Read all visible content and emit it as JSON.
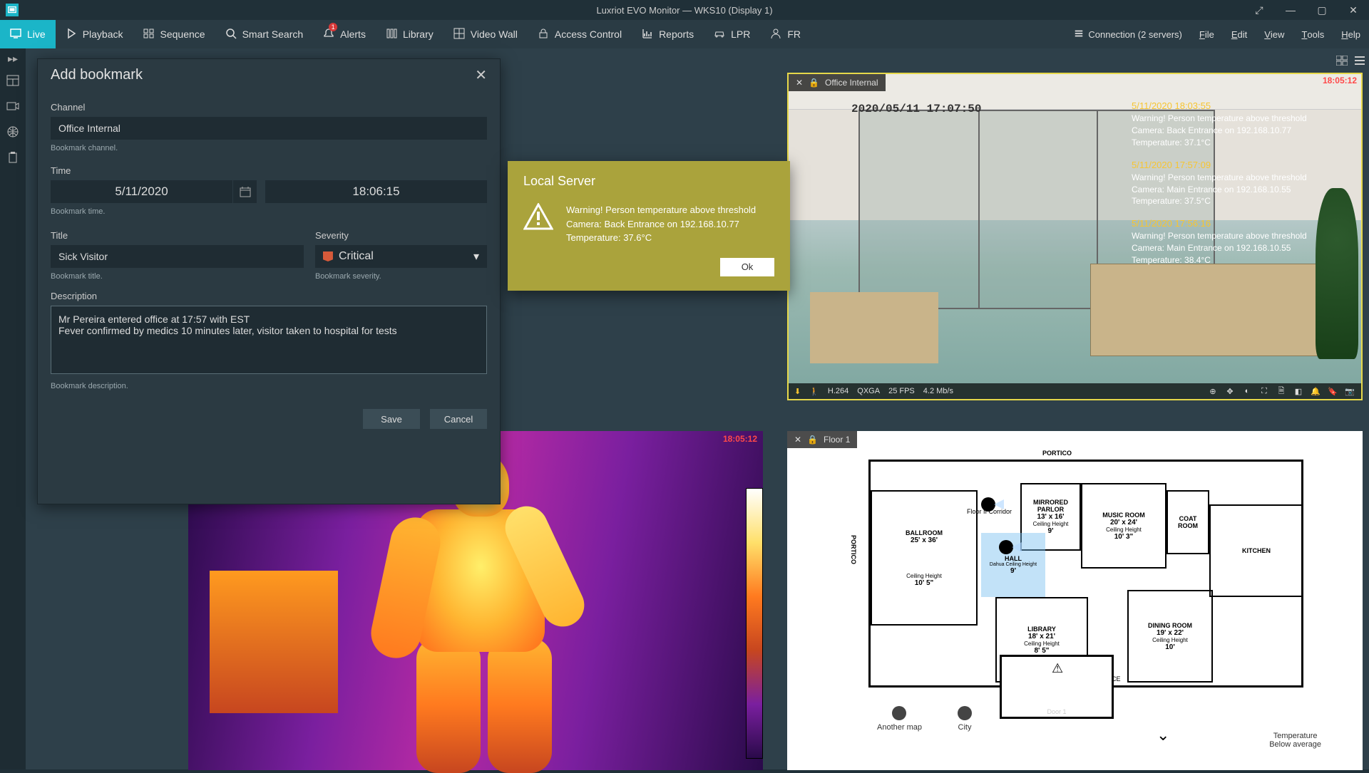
{
  "app_title": "Luxriot EVO Monitor — WKS10 (Display 1)",
  "tabs": {
    "live": "Live",
    "playback": "Playback",
    "sequence": "Sequence",
    "smart_search": "Smart Search",
    "alerts": "Alerts",
    "alerts_badge": "1",
    "library": "Library",
    "video_wall": "Video Wall",
    "access_control": "Access Control",
    "reports": "Reports",
    "lpr": "LPR",
    "fr": "FR"
  },
  "right_menu": {
    "connection": "Connection (2 servers)",
    "file": "File",
    "edit": "Edit",
    "view": "View",
    "tools": "Tools",
    "help": "Help"
  },
  "bookmark": {
    "title": "Add bookmark",
    "channel_label": "Channel",
    "channel_value": "Office Internal",
    "channel_hint": "Bookmark channel.",
    "time_label": "Time",
    "date_value": "5/11/2020",
    "time_value": "18:06:15",
    "time_hint": "Bookmark time.",
    "title_label": "Title",
    "title_value": "Sick Visitor",
    "title_hint": "Bookmark title.",
    "severity_label": "Severity",
    "severity_value": "Critical",
    "severity_hint": "Bookmark severity.",
    "description_label": "Description",
    "description_value": "Mr Pereira entered office at 17:57 with EST\nFever confirmed by medics 10 minutes later, visitor taken to hospital for tests",
    "description_hint": "Bookmark description.",
    "save": "Save",
    "cancel": "Cancel"
  },
  "alert_dialog": {
    "title": "Local Server",
    "line1": "Warning! Person temperature above threshold",
    "line2": "Camera: Back Entrance on 192.168.10.77",
    "line3": "Temperature: 37.6°C",
    "ok": "Ok"
  },
  "office_tile": {
    "name": "Office Internal",
    "clock": "18:05:12",
    "osd": "2020/05/11 17:07:50",
    "stats": {
      "codec": "H.264",
      "res": "QXGA",
      "fps": "25 FPS",
      "rate": "4.2 Mb/s"
    },
    "alerts": [
      {
        "time": "5/11/2020 18:03:55",
        "l1": "Warning! Person temperature above threshold",
        "l2": "Camera: Back Entrance on 192.168.10.77",
        "l3": "Temperature: 37.1°C"
      },
      {
        "time": "5/11/2020 17:57:09",
        "l1": "Warning! Person temperature above threshold",
        "l2": "Camera: Main Entrance on 192.168.10.55",
        "l3": "Temperature: 37.5°C"
      },
      {
        "time": "5/11/2020 17:56:16",
        "l1": "Warning! Person temperature above threshold",
        "l2": "Camera: Main Entrance on 192.168.10.55",
        "l3": "Temperature: 38.4°C"
      }
    ]
  },
  "thermal_tile": {
    "clock": "18:05:12"
  },
  "floor_tile": {
    "name": "Floor 1",
    "rooms": {
      "ballroom": {
        "name": "BALLROOM",
        "dim": "25' x 36'",
        "ch_l": "Ceiling Height",
        "ch": "10' 5\""
      },
      "mirrored": {
        "name": "MIRRORED PARLOR",
        "dim": "13' x 16'",
        "ch_l": "Ceiling Height",
        "ch": "9'"
      },
      "music": {
        "name": "MUSIC ROOM",
        "dim": "20' x 24'",
        "ch_l": "Ceiling Height",
        "ch": "10' 3\""
      },
      "hall": {
        "name": "HALL",
        "ch_l": "Ceiling Height",
        "ch": "9'"
      },
      "library": {
        "name": "LIBRARY",
        "dim": "18' x 21'",
        "ch_l": "Ceiling Height",
        "ch": "8' 5\""
      },
      "dining": {
        "name": "DINING ROOM",
        "dim": "19' x 22'",
        "ch_l": "Ceiling Height",
        "ch": "10'"
      },
      "coat": {
        "name": "COAT ROOM"
      },
      "kitchen": {
        "name": "KITCHEN"
      }
    },
    "labels": {
      "portico_top": "PORTICO",
      "portico_left": "PORTICO",
      "corridor": "Floor II Corridor",
      "main_entrance": "MAIN ENTRANCE",
      "door1": "Door 1"
    },
    "nav": {
      "another": "Another map",
      "city": "City"
    },
    "legend": {
      "l1": "Temperature",
      "l2": "Below average"
    }
  }
}
